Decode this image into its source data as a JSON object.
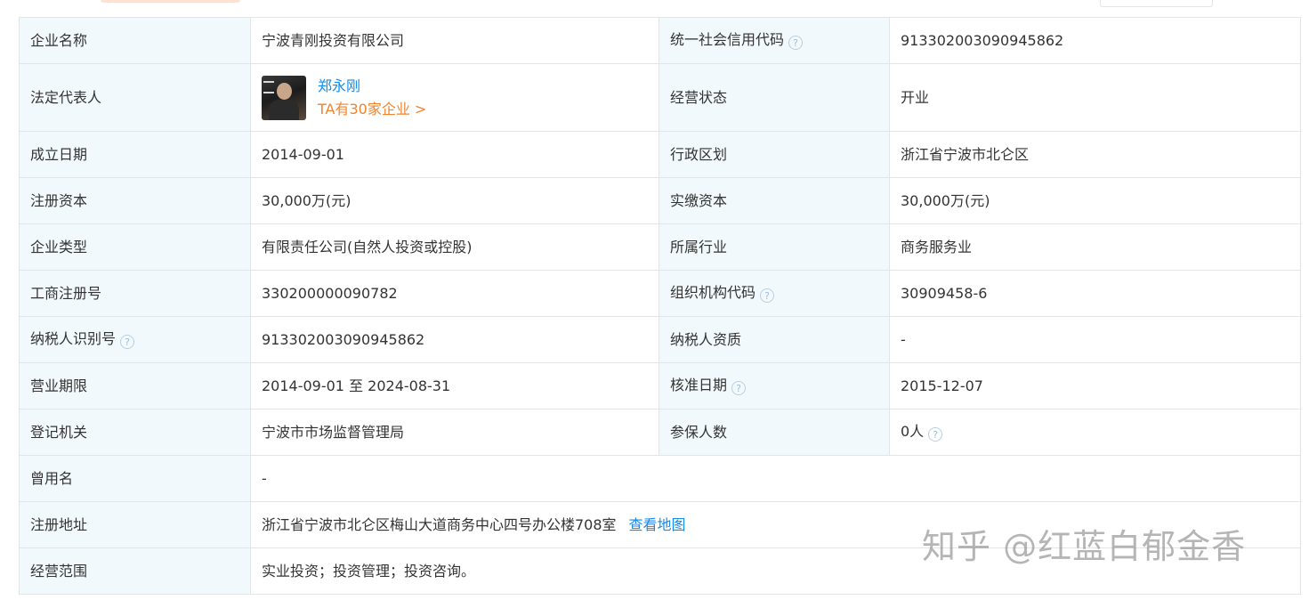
{
  "rows": [
    {
      "label1": "企业名称",
      "value1": "宁波青刚投资有限公司",
      "label2": "统一社会信用代码",
      "value2": "913302003090945862"
    },
    {
      "label1": "法定代表人",
      "rep_name": "郑永刚",
      "rep_link": "TA有30家企业 >",
      "label2": "经营状态",
      "value2": "开业"
    },
    {
      "label1": "成立日期",
      "value1": "2014-09-01",
      "label2": "行政区划",
      "value2": "浙江省宁波市北仑区"
    },
    {
      "label1": "注册资本",
      "value1": "30,000万(元)",
      "label2": "实缴资本",
      "value2": "30,000万(元)"
    },
    {
      "label1": "企业类型",
      "value1": "有限责任公司(自然人投资或控股)",
      "label2": "所属行业",
      "value2": "商务服务业"
    },
    {
      "label1": "工商注册号",
      "value1": "330200000090782",
      "label2": "组织机构代码",
      "value2": "30909458-6"
    },
    {
      "label1": "纳税人识别号",
      "value1": "913302003090945862",
      "label2": "纳税人资质",
      "value2": "-"
    },
    {
      "label1": "营业期限",
      "value1": "2014-09-01 至 2024-08-31",
      "label2": "核准日期",
      "value2": "2015-12-07"
    },
    {
      "label1": "登记机关",
      "value1": "宁波市市场监督管理局",
      "label2": "参保人数",
      "value2": "0人"
    },
    {
      "label1": "曾用名",
      "value1": "-"
    },
    {
      "label1": "注册地址",
      "value1": "浙江省宁波市北仑区梅山大道商务中心四号办公楼708室",
      "map_link": "查看地图"
    },
    {
      "label1": "经营范围",
      "value1": "实业投资；投资管理；投资咨询。"
    }
  ],
  "help_icon": "?",
  "watermark": "知乎 @红蓝白郁金香",
  "colors": {
    "label_bg": "#f2f9fc",
    "border": "#e4e4e4",
    "link_blue": "#128bed",
    "link_orange": "#f0832e"
  }
}
